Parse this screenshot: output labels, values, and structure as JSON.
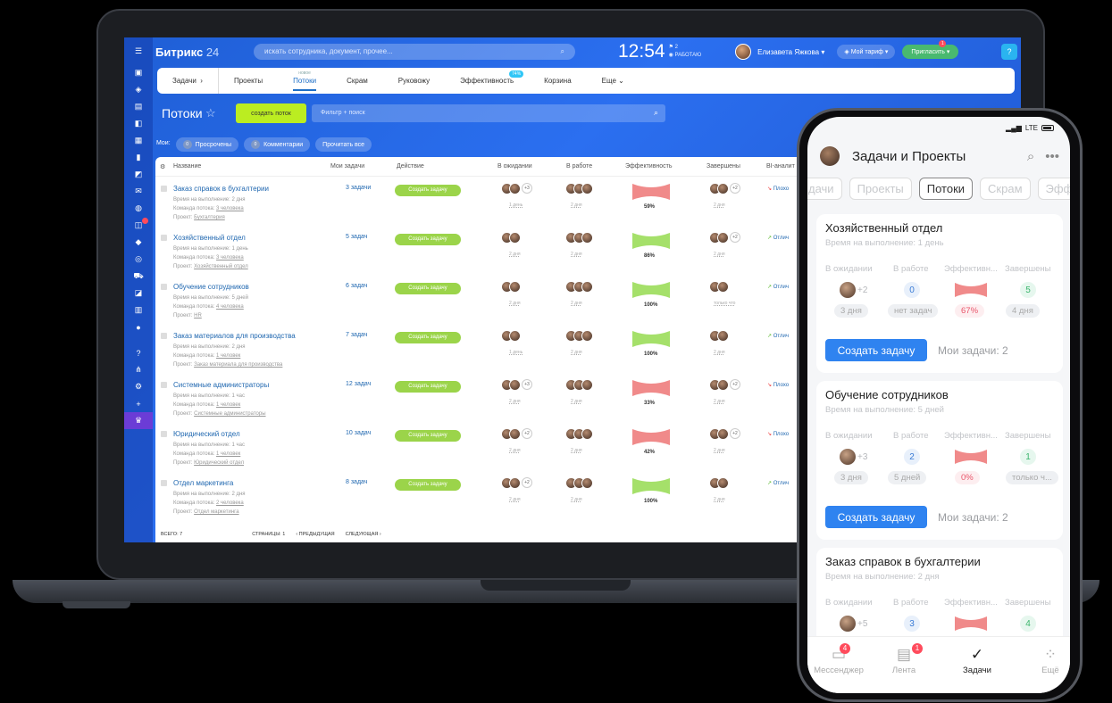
{
  "laptop": {
    "brand": "Битрикс",
    "brand_num": "24",
    "search_placeholder": "искать сотрудника, документ, прочее...",
    "clock": "12:54",
    "clock_flag": "2",
    "clock_status": "РАБОТАЮ",
    "user_name": "Елизавета Яжкова",
    "tariff": "Мой тариф",
    "invite": "Пригласить",
    "invite_badge": "1",
    "help": "?",
    "tabs": {
      "tasks": "Задачи",
      "projects": "Проекты",
      "flows": "Потоки",
      "flows_sup": "новое",
      "scrum": "Скрам",
      "manage": "Руковожу",
      "efficiency": "Эффективность",
      "efficiency_badge": "74%",
      "trash": "Корзина",
      "more": "Еще"
    },
    "page_title": "Потоки",
    "create_flow": "создать поток",
    "filter_placeholder": "Фильтр + поиск",
    "counters": {
      "label": "Мои:",
      "overdue": "Просрочены",
      "overdue_n": "0",
      "comments": "Комментарии",
      "comments_n": "0",
      "read_all": "Прочитать все"
    },
    "columns": {
      "name": "Название",
      "my": "Мои задачи",
      "action": "Действие",
      "waiting": "В ожидании",
      "inwork": "В работе",
      "eff": "Эффективность",
      "done": "Завершены",
      "bi": "BI-аналит"
    },
    "meta_labels": {
      "time": "Время на выполнение:",
      "team": "Команда потока:",
      "project": "Проект:"
    },
    "action_label": "Создать задачу",
    "rows": [
      {
        "name": "Заказ справок в бухгалтерии",
        "time": "2 дня",
        "team": "3 человека",
        "project": "Бухгалтерия",
        "my": "3 задачи",
        "w_more": "+3",
        "w_sub": "1 день",
        "i_sub": "2 дня",
        "eff": "59%",
        "eff_good": false,
        "d_more": "+2",
        "d_sub": "2 дня",
        "bi": "Плохо"
      },
      {
        "name": "Хозяйственный отдел",
        "time": "1 день",
        "team": "3 человека",
        "project": "Хозяйственный отдел",
        "my": "5 задач",
        "w_more": "",
        "w_sub": "2 дня",
        "i_sub": "2 дня",
        "eff": "86%",
        "eff_good": true,
        "d_more": "+2",
        "d_sub": "2 дня",
        "bi": "Отлич"
      },
      {
        "name": "Обучение сотрудников",
        "time": "5 дней",
        "team": "4 человека",
        "project": "HR",
        "my": "6 задач",
        "w_more": "",
        "w_sub": "2 дня",
        "i_sub": "2 дня",
        "eff": "100%",
        "eff_good": true,
        "d_more": "",
        "d_sub": "только что",
        "bi": "Отлич"
      },
      {
        "name": "Заказ материалов для производства",
        "time": "2 дня",
        "team": "1 человек",
        "project": "Заказ материала для производства",
        "my": "7 задач",
        "w_more": "",
        "w_sub": "1 день",
        "i_sub": "2 дня",
        "eff": "100%",
        "eff_good": true,
        "d_more": "",
        "d_sub": "2 дня",
        "bi": "Отлич"
      },
      {
        "name": "Системные администраторы",
        "time": "1 час",
        "team": "1 человек",
        "project": "Системные администраторы",
        "my": "12 задач",
        "w_more": "+3",
        "w_sub": "2 дня",
        "i_sub": "2 дня",
        "eff": "33%",
        "eff_good": false,
        "d_more": "+2",
        "d_sub": "2 дня",
        "bi": "Плохо"
      },
      {
        "name": "Юридический отдел",
        "time": "1 час",
        "team": "1 человек",
        "project": "Юридический отдел",
        "my": "10 задач",
        "w_more": "+2",
        "w_sub": "2 дня",
        "i_sub": "2 дня",
        "eff": "42%",
        "eff_good": false,
        "d_more": "+2",
        "d_sub": "2 дня",
        "bi": "Плохо"
      },
      {
        "name": "Отдел маркетинга",
        "time": "2 дня",
        "team": "2 человека",
        "project": "Отдел маркетинга",
        "my": "8 задач",
        "w_more": "+2",
        "w_sub": "2 дня",
        "i_sub": "2 дня",
        "eff": "100%",
        "eff_good": true,
        "d_more": "",
        "d_sub": "2 дня",
        "bi": "Отлич"
      }
    ],
    "footer": {
      "total": "ВСЕГО: 7",
      "pages": "СТРАНИЦЫ: 1",
      "prev": "‹ ПРЕДЫДУЩАЯ",
      "next": "СЛЕДУЮЩАЯ ›"
    }
  },
  "phone": {
    "status": "LTE",
    "title": "Задачи и Проекты",
    "chips": [
      "дачи",
      "Проекты",
      "Потоки",
      "Скрам",
      "Эффе"
    ],
    "col_labels": [
      "В ожидании",
      "В работе",
      "Эффективн...",
      "Завершены"
    ],
    "create_btn": "Создать задачу",
    "cards": [
      {
        "title": "Хозяйственный отдел",
        "time": "Время на выполнение: 1 день",
        "w_more": "+2",
        "inwork": "0",
        "done": "5",
        "b1": "3 дня",
        "b2": "нет задач",
        "b3": "67%",
        "b4": "4 дня",
        "my": "Мои задачи: 2"
      },
      {
        "title": "Обучение сотрудников",
        "time": "Время на выполнение: 5 дней",
        "w_more": "+3",
        "inwork": "2",
        "done": "1",
        "b1": "3 дня",
        "b2": "5 дней",
        "b3": "0%",
        "b4": "только ч...",
        "my": "Мои задачи: 2"
      },
      {
        "title": "Заказ справок в бухгалтерии",
        "time": "Время на выполнение: 2 дня",
        "w_more": "+5",
        "inwork": "3",
        "done": "4"
      }
    ],
    "tabbar": [
      {
        "label": "Мессенджер",
        "badge": "4"
      },
      {
        "label": "Лента",
        "badge": "1"
      },
      {
        "label": "Задачи",
        "badge": ""
      },
      {
        "label": "Ещё",
        "badge": ""
      }
    ]
  },
  "colors": {
    "accent": "#2f83f0",
    "green_btn": "#bbed21",
    "bad": "#f08a8a",
    "good": "#a5e06a"
  }
}
